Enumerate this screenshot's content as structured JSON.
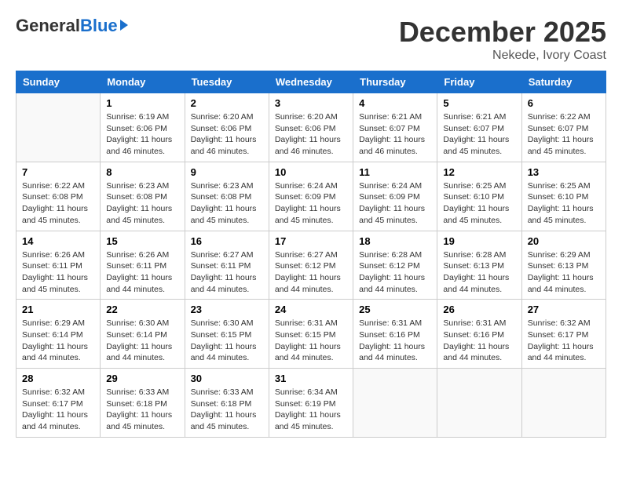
{
  "logo": {
    "general": "General",
    "blue": "Blue"
  },
  "title": "December 2025",
  "location": "Nekede, Ivory Coast",
  "weekdays": [
    "Sunday",
    "Monday",
    "Tuesday",
    "Wednesday",
    "Thursday",
    "Friday",
    "Saturday"
  ],
  "weeks": [
    [
      {
        "day": null,
        "sunrise": null,
        "sunset": null,
        "daylight": null
      },
      {
        "day": "1",
        "sunrise": "Sunrise: 6:19 AM",
        "sunset": "Sunset: 6:06 PM",
        "daylight": "Daylight: 11 hours and 46 minutes."
      },
      {
        "day": "2",
        "sunrise": "Sunrise: 6:20 AM",
        "sunset": "Sunset: 6:06 PM",
        "daylight": "Daylight: 11 hours and 46 minutes."
      },
      {
        "day": "3",
        "sunrise": "Sunrise: 6:20 AM",
        "sunset": "Sunset: 6:06 PM",
        "daylight": "Daylight: 11 hours and 46 minutes."
      },
      {
        "day": "4",
        "sunrise": "Sunrise: 6:21 AM",
        "sunset": "Sunset: 6:07 PM",
        "daylight": "Daylight: 11 hours and 46 minutes."
      },
      {
        "day": "5",
        "sunrise": "Sunrise: 6:21 AM",
        "sunset": "Sunset: 6:07 PM",
        "daylight": "Daylight: 11 hours and 45 minutes."
      },
      {
        "day": "6",
        "sunrise": "Sunrise: 6:22 AM",
        "sunset": "Sunset: 6:07 PM",
        "daylight": "Daylight: 11 hours and 45 minutes."
      }
    ],
    [
      {
        "day": "7",
        "sunrise": "Sunrise: 6:22 AM",
        "sunset": "Sunset: 6:08 PM",
        "daylight": "Daylight: 11 hours and 45 minutes."
      },
      {
        "day": "8",
        "sunrise": "Sunrise: 6:23 AM",
        "sunset": "Sunset: 6:08 PM",
        "daylight": "Daylight: 11 hours and 45 minutes."
      },
      {
        "day": "9",
        "sunrise": "Sunrise: 6:23 AM",
        "sunset": "Sunset: 6:08 PM",
        "daylight": "Daylight: 11 hours and 45 minutes."
      },
      {
        "day": "10",
        "sunrise": "Sunrise: 6:24 AM",
        "sunset": "Sunset: 6:09 PM",
        "daylight": "Daylight: 11 hours and 45 minutes."
      },
      {
        "day": "11",
        "sunrise": "Sunrise: 6:24 AM",
        "sunset": "Sunset: 6:09 PM",
        "daylight": "Daylight: 11 hours and 45 minutes."
      },
      {
        "day": "12",
        "sunrise": "Sunrise: 6:25 AM",
        "sunset": "Sunset: 6:10 PM",
        "daylight": "Daylight: 11 hours and 45 minutes."
      },
      {
        "day": "13",
        "sunrise": "Sunrise: 6:25 AM",
        "sunset": "Sunset: 6:10 PM",
        "daylight": "Daylight: 11 hours and 45 minutes."
      }
    ],
    [
      {
        "day": "14",
        "sunrise": "Sunrise: 6:26 AM",
        "sunset": "Sunset: 6:11 PM",
        "daylight": "Daylight: 11 hours and 45 minutes."
      },
      {
        "day": "15",
        "sunrise": "Sunrise: 6:26 AM",
        "sunset": "Sunset: 6:11 PM",
        "daylight": "Daylight: 11 hours and 44 minutes."
      },
      {
        "day": "16",
        "sunrise": "Sunrise: 6:27 AM",
        "sunset": "Sunset: 6:11 PM",
        "daylight": "Daylight: 11 hours and 44 minutes."
      },
      {
        "day": "17",
        "sunrise": "Sunrise: 6:27 AM",
        "sunset": "Sunset: 6:12 PM",
        "daylight": "Daylight: 11 hours and 44 minutes."
      },
      {
        "day": "18",
        "sunrise": "Sunrise: 6:28 AM",
        "sunset": "Sunset: 6:12 PM",
        "daylight": "Daylight: 11 hours and 44 minutes."
      },
      {
        "day": "19",
        "sunrise": "Sunrise: 6:28 AM",
        "sunset": "Sunset: 6:13 PM",
        "daylight": "Daylight: 11 hours and 44 minutes."
      },
      {
        "day": "20",
        "sunrise": "Sunrise: 6:29 AM",
        "sunset": "Sunset: 6:13 PM",
        "daylight": "Daylight: 11 hours and 44 minutes."
      }
    ],
    [
      {
        "day": "21",
        "sunrise": "Sunrise: 6:29 AM",
        "sunset": "Sunset: 6:14 PM",
        "daylight": "Daylight: 11 hours and 44 minutes."
      },
      {
        "day": "22",
        "sunrise": "Sunrise: 6:30 AM",
        "sunset": "Sunset: 6:14 PM",
        "daylight": "Daylight: 11 hours and 44 minutes."
      },
      {
        "day": "23",
        "sunrise": "Sunrise: 6:30 AM",
        "sunset": "Sunset: 6:15 PM",
        "daylight": "Daylight: 11 hours and 44 minutes."
      },
      {
        "day": "24",
        "sunrise": "Sunrise: 6:31 AM",
        "sunset": "Sunset: 6:15 PM",
        "daylight": "Daylight: 11 hours and 44 minutes."
      },
      {
        "day": "25",
        "sunrise": "Sunrise: 6:31 AM",
        "sunset": "Sunset: 6:16 PM",
        "daylight": "Daylight: 11 hours and 44 minutes."
      },
      {
        "day": "26",
        "sunrise": "Sunrise: 6:31 AM",
        "sunset": "Sunset: 6:16 PM",
        "daylight": "Daylight: 11 hours and 44 minutes."
      },
      {
        "day": "27",
        "sunrise": "Sunrise: 6:32 AM",
        "sunset": "Sunset: 6:17 PM",
        "daylight": "Daylight: 11 hours and 44 minutes."
      }
    ],
    [
      {
        "day": "28",
        "sunrise": "Sunrise: 6:32 AM",
        "sunset": "Sunset: 6:17 PM",
        "daylight": "Daylight: 11 hours and 44 minutes."
      },
      {
        "day": "29",
        "sunrise": "Sunrise: 6:33 AM",
        "sunset": "Sunset: 6:18 PM",
        "daylight": "Daylight: 11 hours and 45 minutes."
      },
      {
        "day": "30",
        "sunrise": "Sunrise: 6:33 AM",
        "sunset": "Sunset: 6:18 PM",
        "daylight": "Daylight: 11 hours and 45 minutes."
      },
      {
        "day": "31",
        "sunrise": "Sunrise: 6:34 AM",
        "sunset": "Sunset: 6:19 PM",
        "daylight": "Daylight: 11 hours and 45 minutes."
      },
      {
        "day": null,
        "sunrise": null,
        "sunset": null,
        "daylight": null
      },
      {
        "day": null,
        "sunrise": null,
        "sunset": null,
        "daylight": null
      },
      {
        "day": null,
        "sunrise": null,
        "sunset": null,
        "daylight": null
      }
    ]
  ]
}
